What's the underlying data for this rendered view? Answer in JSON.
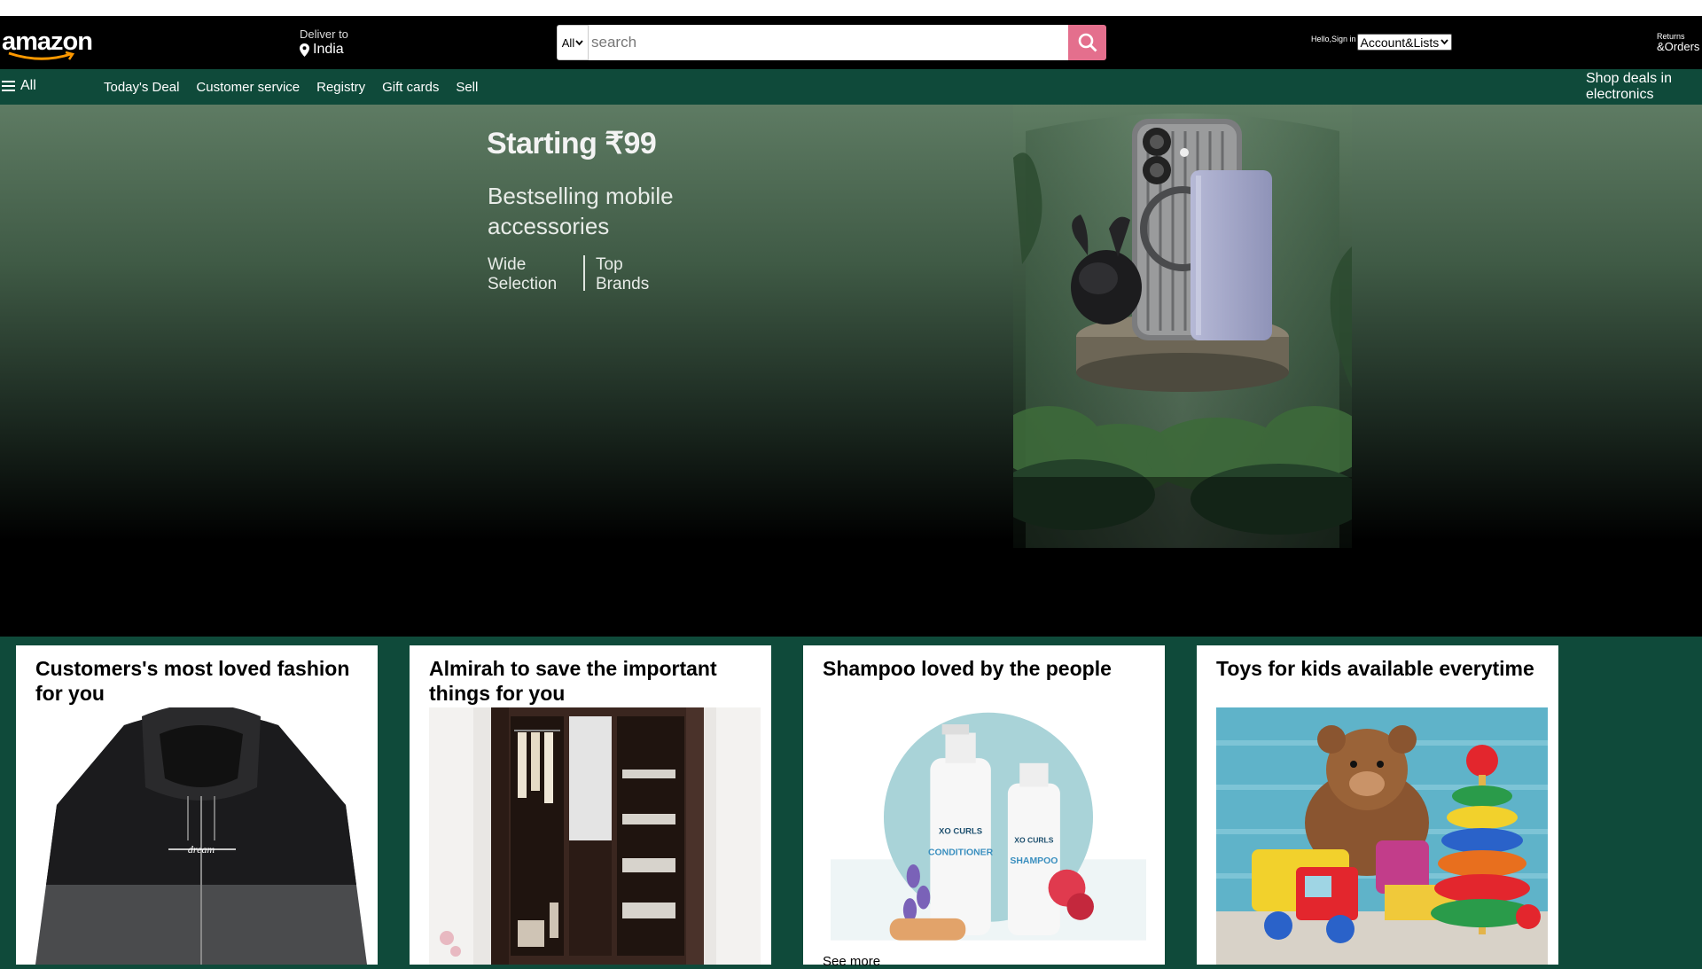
{
  "header": {
    "logo_text": "amazon",
    "deliver_label": "Deliver to",
    "deliver_location": "India",
    "search": {
      "category": "All",
      "placeholder": "search"
    },
    "hello": "Hello,Sign in",
    "account_select": "Account&Lists",
    "returns_line1": "Returns",
    "returns_line2": "&Orders"
  },
  "subnav": {
    "all_label": "All",
    "links": [
      "Today's Deal",
      "Customer service",
      "Registry",
      "Gift cards",
      "Sell"
    ],
    "deals_label": "Shop deals in electronics"
  },
  "hero": {
    "headline": "Starting ₹99",
    "subhead": "Bestselling mobile accessories",
    "feature1": "Wide Selection",
    "feature2": "Top Brands"
  },
  "cards": [
    {
      "title": "Customers's most loved fashion for you"
    },
    {
      "title": "Almirah to save the important things for you"
    },
    {
      "title": "Shampoo loved by the people",
      "see_more": "See more"
    },
    {
      "title": "Toys for kids available everytime"
    }
  ],
  "colors": {
    "accent": "#e46f8d",
    "navbar": "#000000",
    "subnav": "#0f4a3a"
  }
}
